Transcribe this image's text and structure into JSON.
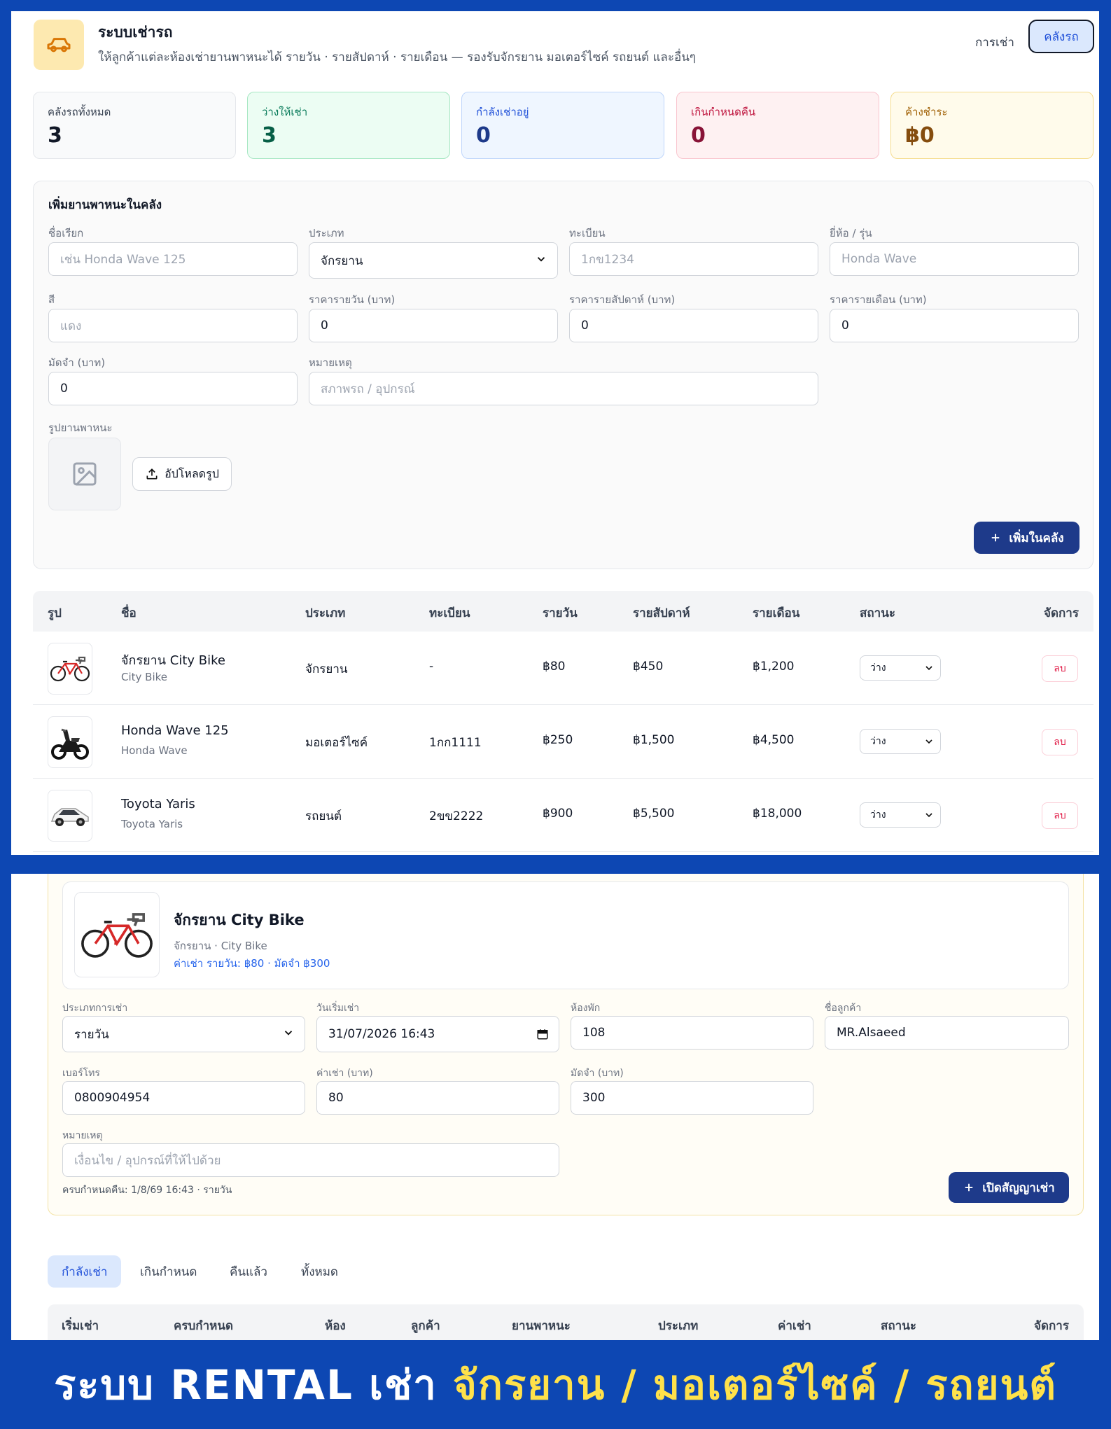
{
  "header": {
    "title": "ระบบเช่ารถ",
    "subtitle": "ให้ลูกค้าแต่ละห้องเช่ายานพาหนะได้ รายวัน · รายสัปดาห์ · รายเดือน — รองรับจักรยาน มอเตอร์ไซค์ รถยนต์ และอื่นๆ",
    "nav_rental": "การเช่า",
    "nav_warehouse": "คลังรถ",
    "logo_icon": "car-icon"
  },
  "stats": [
    {
      "label": "คลังรถทั้งหมด",
      "value": "3"
    },
    {
      "label": "ว่างให้เช่า",
      "value": "3"
    },
    {
      "label": "กำลังเช่าอยู่",
      "value": "0"
    },
    {
      "label": "เกินกำหนดคืน",
      "value": "0"
    },
    {
      "label": "ค้างชำระ",
      "value": "฿0"
    }
  ],
  "add_form": {
    "title": "เพิ่มยานพาหนะในคลัง",
    "name_label": "ชื่อเรียก",
    "name_placeholder": "เช่น Honda Wave 125",
    "type_label": "ประเภท",
    "type_value": "จักรยาน",
    "plate_label": "ทะเบียน",
    "plate_placeholder": "1กข1234",
    "brand_label": "ยี่ห้อ / รุ่น",
    "brand_placeholder": "Honda Wave",
    "color_label": "สี",
    "color_placeholder": "แดง",
    "daily_label": "ราคารายวัน (บาท)",
    "daily_value": "0",
    "weekly_label": "ราคารายสัปดาห์ (บาท)",
    "weekly_value": "0",
    "monthly_label": "ราคารายเดือน (บาท)",
    "monthly_value": "0",
    "deposit_label": "มัดจำ (บาท)",
    "deposit_value": "0",
    "note_label": "หมายเหตุ",
    "note_placeholder": "สภาพรถ / อุปกรณ์",
    "image_label": "รูปยานพาหนะ",
    "upload_label": "อัปโหลดรูป",
    "add_button": "เพิ่มในคลัง"
  },
  "vehicle_table": {
    "headers": [
      "รูป",
      "ชื่อ",
      "ประเภท",
      "ทะเบียน",
      "รายวัน",
      "รายสัปดาห์",
      "รายเดือน",
      "สถานะ",
      "จัดการ"
    ],
    "rows": [
      {
        "name": "จักรยาน City Bike",
        "model": "City Bike",
        "type": "จักรยาน",
        "plate": "-",
        "daily": "฿80",
        "weekly": "฿450",
        "monthly": "฿1,200",
        "status": "ว่าง",
        "action": "ลบ",
        "icon": "bicycle-icon"
      },
      {
        "name": "Honda Wave 125",
        "model": "Honda Wave",
        "type": "มอเตอร์ไซค์",
        "plate": "1กก1111",
        "daily": "฿250",
        "weekly": "฿1,500",
        "monthly": "฿4,500",
        "status": "ว่าง",
        "action": "ลบ",
        "icon": "motorcycle-icon"
      },
      {
        "name": "Toyota Yaris",
        "model": "Toyota Yaris",
        "type": "รถยนต์",
        "plate": "2ขข2222",
        "daily": "฿900",
        "weekly": "฿5,500",
        "monthly": "฿18,000",
        "status": "ว่าง",
        "action": "ลบ",
        "icon": "car-photo-icon"
      }
    ]
  },
  "rental_form": {
    "vehicle_name": "จักรยาน City Bike",
    "vehicle_meta": "จักรยาน · City Bike",
    "vehicle_price": "ค่าเช่า รายวัน: ฿80 · มัดจำ ฿300",
    "rent_type_label": "ประเภทการเช่า",
    "rent_type_value": "รายวัน",
    "start_label": "วันเริ่มเช่า",
    "start_value": "31/07/2026 16:43",
    "room_label": "ห้องพัก",
    "room_value": "108",
    "customer_label": "ชื่อลูกค้า",
    "customer_value": "MR.Alsaeed",
    "phone_label": "เบอร์โทร",
    "phone_value": "0800904954",
    "fee_label": "ค่าเช่า (บาท)",
    "fee_value": "80",
    "deposit_label": "มัดจำ (บาท)",
    "deposit_value": "300",
    "note_label": "หมายเหตุ",
    "note_placeholder": "เงื่อนไข / อุปกรณ์ที่ให้ไปด้วย",
    "due_text": "ครบกำหนดคืน: 1/8/69 16:43 · รายวัน",
    "open_button": "เปิดสัญญาเช่า"
  },
  "tabs": [
    "กำลังเช่า",
    "เกินกำหนด",
    "คืนแล้ว",
    "ทั้งหมด"
  ],
  "rental_table_headers": [
    "เริ่มเช่า",
    "ครบกำหนด",
    "ห้อง",
    "ลูกค้า",
    "ยานพาหนะ",
    "ประเภท",
    "ค่าเช่า",
    "สถานะ",
    "จัดการ"
  ],
  "banner": {
    "white": "ระบบ RENTAL เช่า",
    "yellow": "จักรยาน / มอเตอร์ไซค์ / รถยนต์"
  },
  "colors": {
    "accent": "#1e3a8a",
    "brand_blue": "#0d47b3",
    "banner_yellow": "#ffe14a"
  }
}
